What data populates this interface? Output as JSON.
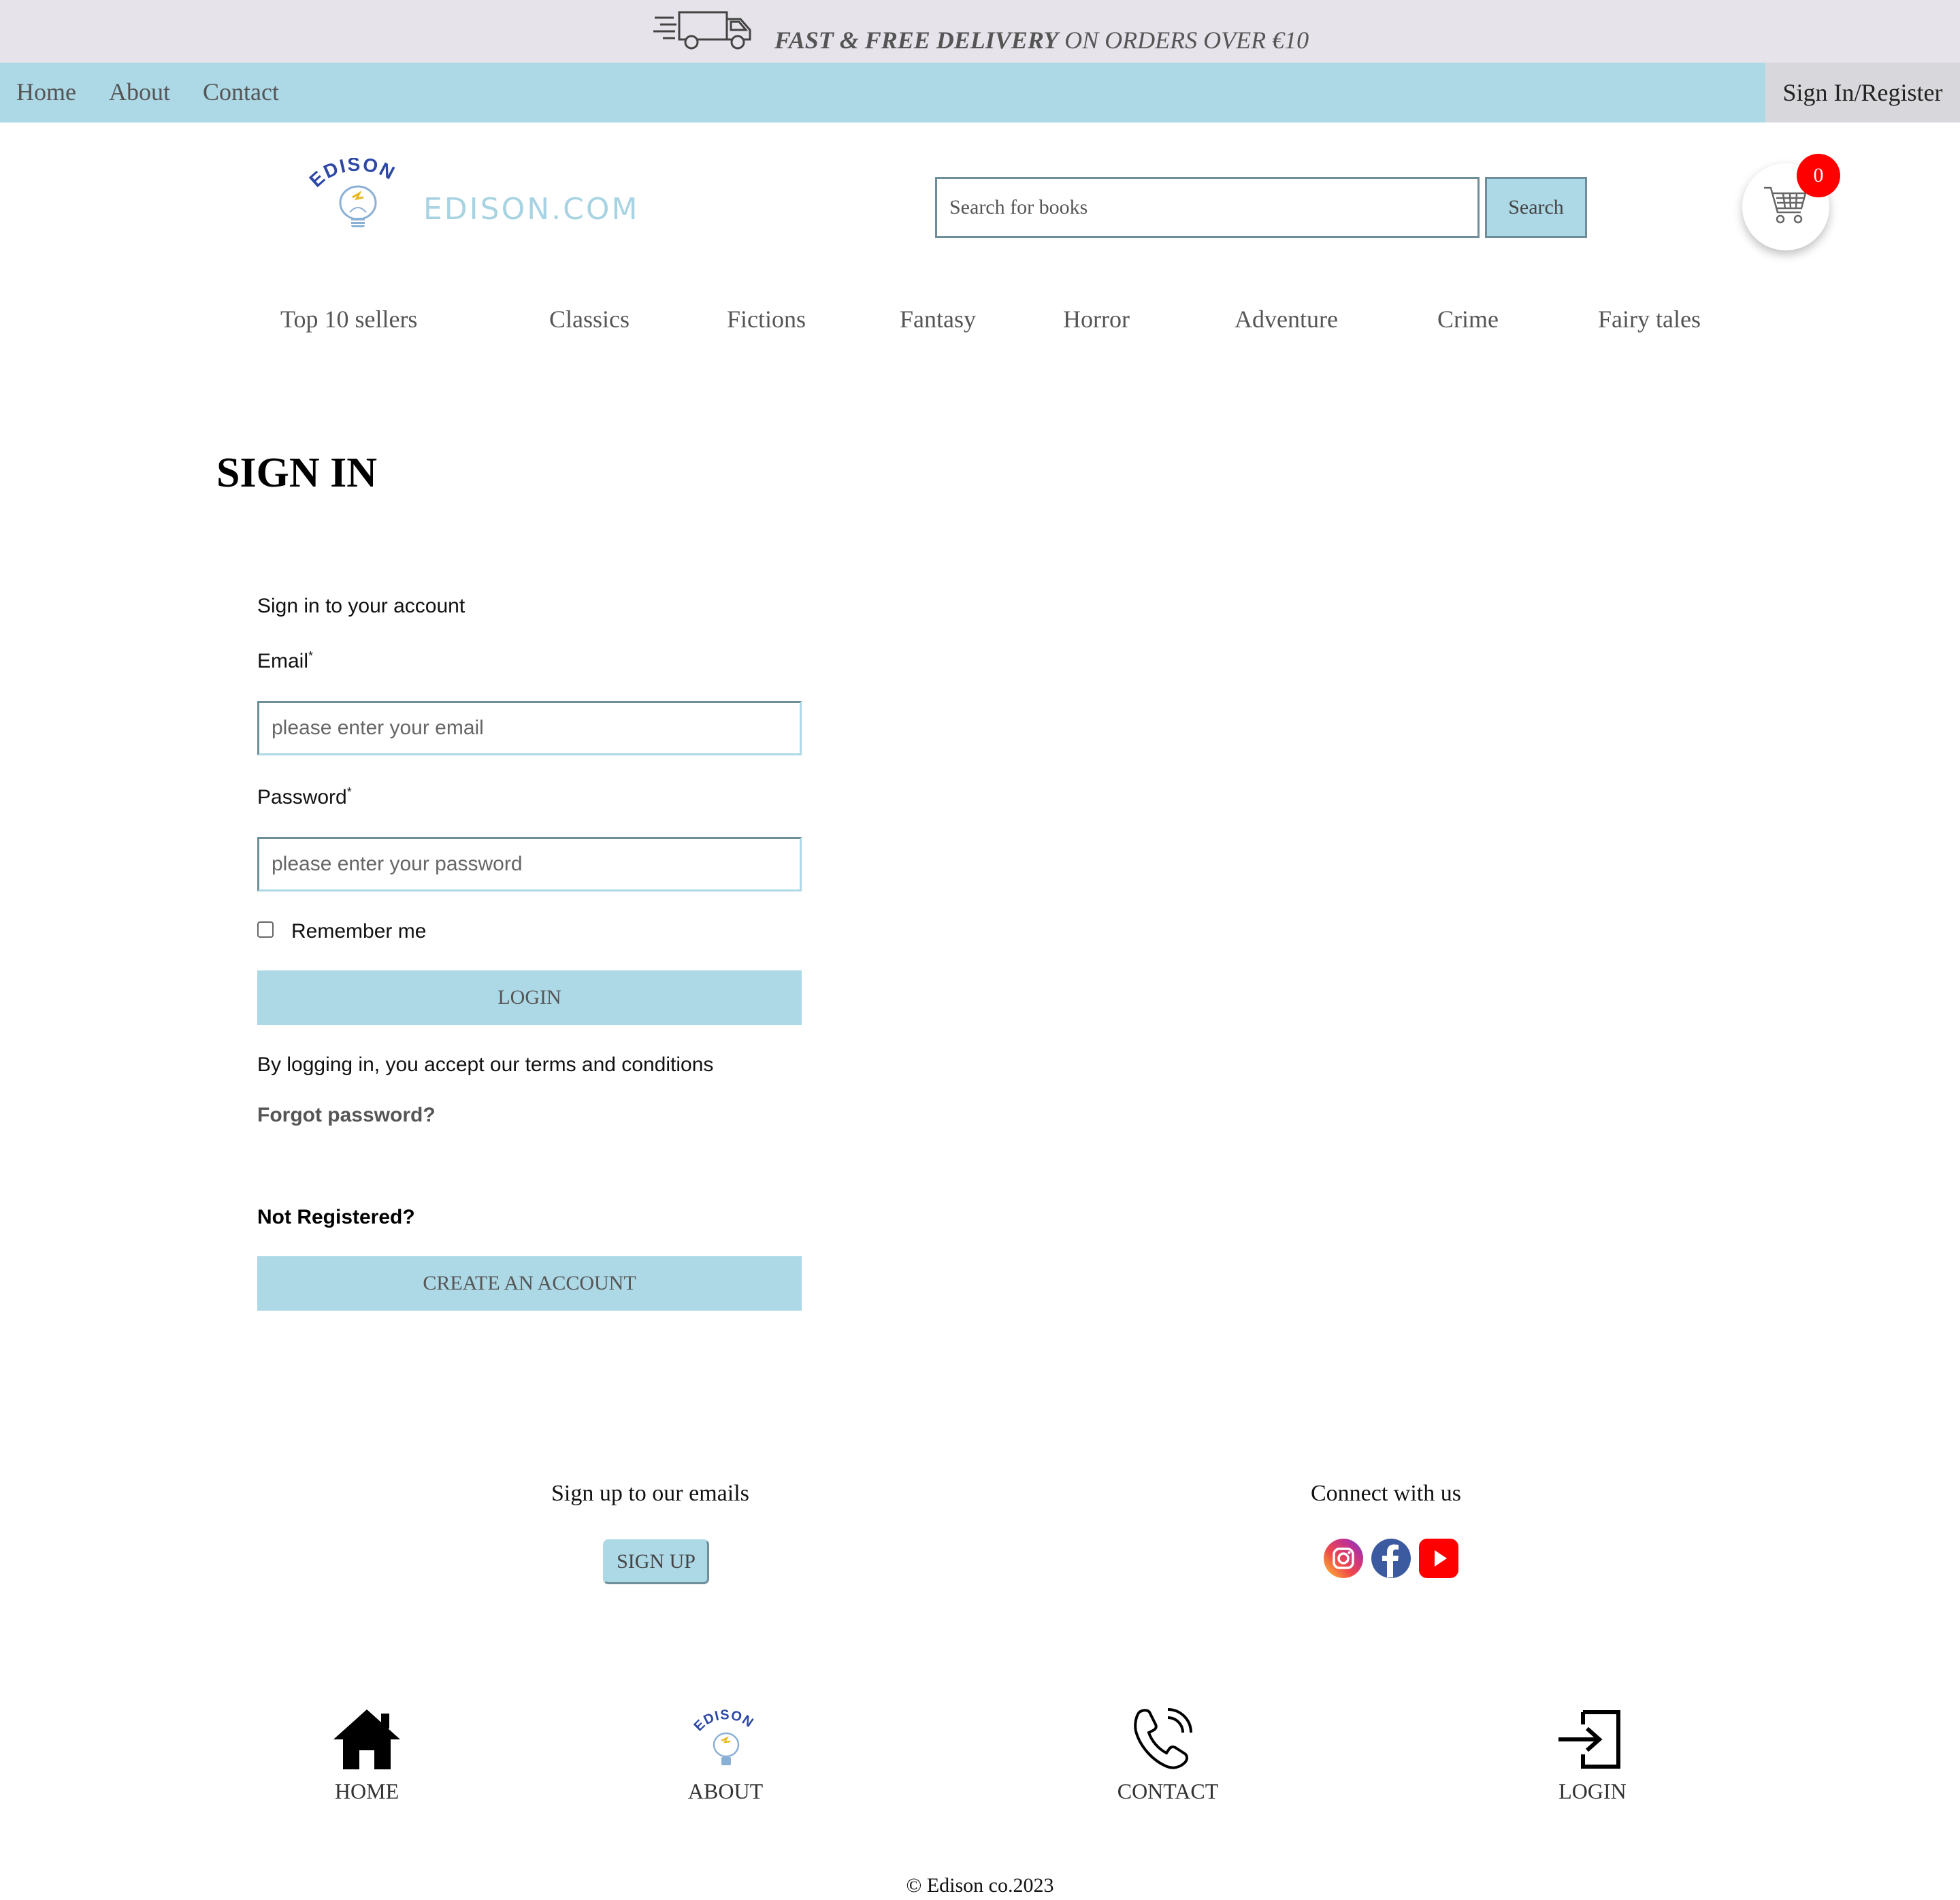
{
  "banner": {
    "bold_text": "FAST & FREE DELIVERY",
    "rest_text": " ON ORDERS OVER €10",
    "icon": "delivery-truck-icon"
  },
  "nav": {
    "home": "Home",
    "about": "About",
    "contact": "Contact",
    "signin": "Sign In/Register"
  },
  "header": {
    "logo_arc_text": "EDISON",
    "logo_text": "EDISON.COM",
    "search_placeholder": "Search for books",
    "search_button": "Search",
    "cart_count": "0",
    "cart_icon": "shopping-cart-icon"
  },
  "categories": [
    "Top 10 sellers",
    "Classics",
    "Fictions",
    "Fantasy",
    "Horror",
    "Adventure",
    "Crime",
    "Fairy tales"
  ],
  "signin": {
    "title": "SIGN IN",
    "subtitle": "Sign in to your account",
    "email_label": "Email",
    "required_mark": "*",
    "email_placeholder": "please enter your email",
    "password_label": "Password",
    "password_placeholder": "please enter your password",
    "remember": "Remember me",
    "login_button": "LOGIN",
    "terms": "By logging in, you accept our terms and conditions",
    "forgot": "Forgot password?",
    "not_registered": "Not Registered?",
    "create_button": "CREATE AN ACCOUNT"
  },
  "footer": {
    "emails_heading": "Sign up to our emails",
    "signup_button": "SIGN UP",
    "connect_heading": "Connect with us",
    "social_icons": [
      "instagram-icon",
      "facebook-icon",
      "youtube-icon"
    ],
    "links": [
      {
        "label": "HOME",
        "icon": "home-icon"
      },
      {
        "label": "ABOUT",
        "icon": "edison-bulb-icon"
      },
      {
        "label": "CONTACT",
        "icon": "phone-icon"
      },
      {
        "label": "LOGIN",
        "icon": "login-icon"
      }
    ],
    "copyright": "© Edison co.2023"
  },
  "colors": {
    "accent": "#add8e6",
    "banner_bg": "#e6e3ea",
    "badge": "#ff0000",
    "logo_text": "#a7d3e2"
  }
}
